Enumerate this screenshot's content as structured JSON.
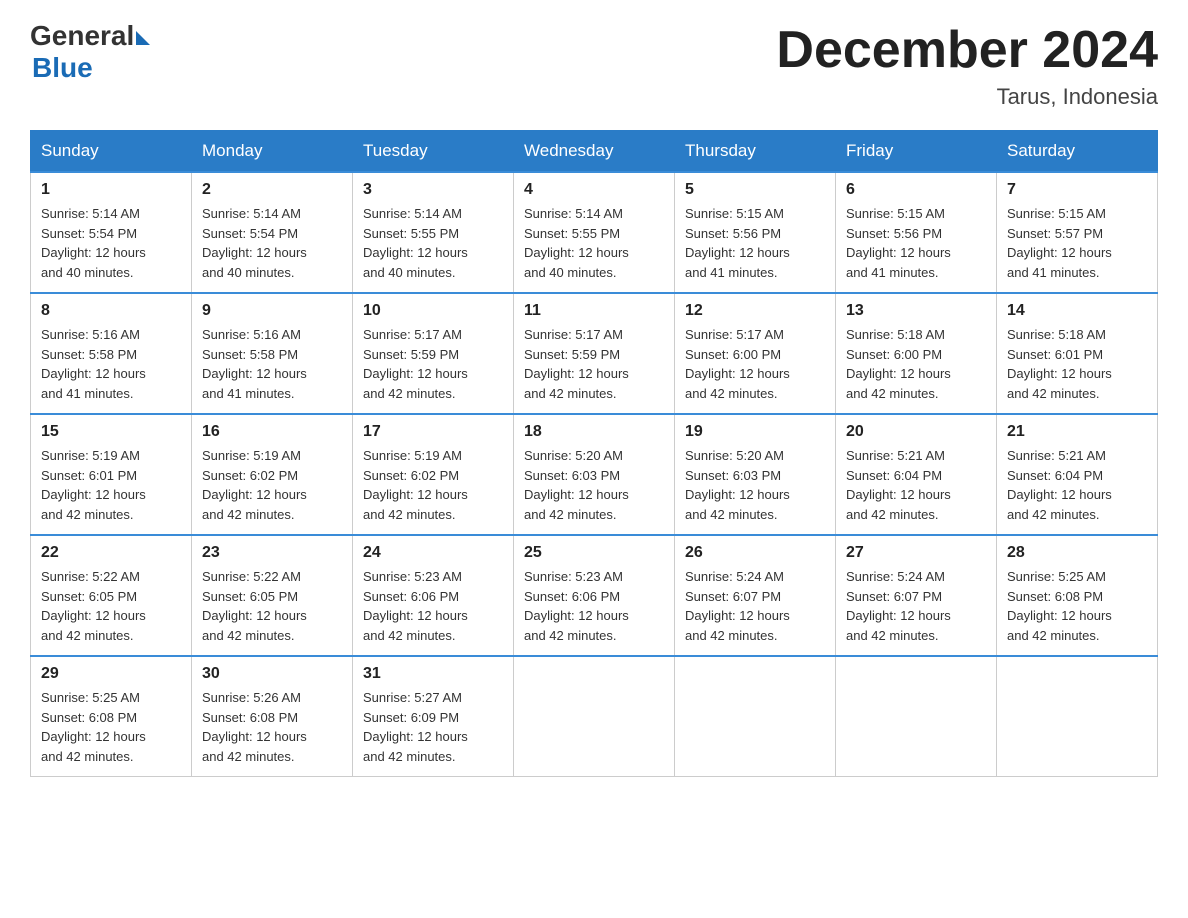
{
  "header": {
    "logo_general": "General",
    "logo_blue": "Blue",
    "month_title": "December 2024",
    "location": "Tarus, Indonesia"
  },
  "days_of_week": [
    "Sunday",
    "Monday",
    "Tuesday",
    "Wednesday",
    "Thursday",
    "Friday",
    "Saturday"
  ],
  "weeks": [
    [
      {
        "day": "1",
        "sunrise": "5:14 AM",
        "sunset": "5:54 PM",
        "daylight": "12 hours and 40 minutes."
      },
      {
        "day": "2",
        "sunrise": "5:14 AM",
        "sunset": "5:54 PM",
        "daylight": "12 hours and 40 minutes."
      },
      {
        "day": "3",
        "sunrise": "5:14 AM",
        "sunset": "5:55 PM",
        "daylight": "12 hours and 40 minutes."
      },
      {
        "day": "4",
        "sunrise": "5:14 AM",
        "sunset": "5:55 PM",
        "daylight": "12 hours and 40 minutes."
      },
      {
        "day": "5",
        "sunrise": "5:15 AM",
        "sunset": "5:56 PM",
        "daylight": "12 hours and 41 minutes."
      },
      {
        "day": "6",
        "sunrise": "5:15 AM",
        "sunset": "5:56 PM",
        "daylight": "12 hours and 41 minutes."
      },
      {
        "day": "7",
        "sunrise": "5:15 AM",
        "sunset": "5:57 PM",
        "daylight": "12 hours and 41 minutes."
      }
    ],
    [
      {
        "day": "8",
        "sunrise": "5:16 AM",
        "sunset": "5:58 PM",
        "daylight": "12 hours and 41 minutes."
      },
      {
        "day": "9",
        "sunrise": "5:16 AM",
        "sunset": "5:58 PM",
        "daylight": "12 hours and 41 minutes."
      },
      {
        "day": "10",
        "sunrise": "5:17 AM",
        "sunset": "5:59 PM",
        "daylight": "12 hours and 42 minutes."
      },
      {
        "day": "11",
        "sunrise": "5:17 AM",
        "sunset": "5:59 PM",
        "daylight": "12 hours and 42 minutes."
      },
      {
        "day": "12",
        "sunrise": "5:17 AM",
        "sunset": "6:00 PM",
        "daylight": "12 hours and 42 minutes."
      },
      {
        "day": "13",
        "sunrise": "5:18 AM",
        "sunset": "6:00 PM",
        "daylight": "12 hours and 42 minutes."
      },
      {
        "day": "14",
        "sunrise": "5:18 AM",
        "sunset": "6:01 PM",
        "daylight": "12 hours and 42 minutes."
      }
    ],
    [
      {
        "day": "15",
        "sunrise": "5:19 AM",
        "sunset": "6:01 PM",
        "daylight": "12 hours and 42 minutes."
      },
      {
        "day": "16",
        "sunrise": "5:19 AM",
        "sunset": "6:02 PM",
        "daylight": "12 hours and 42 minutes."
      },
      {
        "day": "17",
        "sunrise": "5:19 AM",
        "sunset": "6:02 PM",
        "daylight": "12 hours and 42 minutes."
      },
      {
        "day": "18",
        "sunrise": "5:20 AM",
        "sunset": "6:03 PM",
        "daylight": "12 hours and 42 minutes."
      },
      {
        "day": "19",
        "sunrise": "5:20 AM",
        "sunset": "6:03 PM",
        "daylight": "12 hours and 42 minutes."
      },
      {
        "day": "20",
        "sunrise": "5:21 AM",
        "sunset": "6:04 PM",
        "daylight": "12 hours and 42 minutes."
      },
      {
        "day": "21",
        "sunrise": "5:21 AM",
        "sunset": "6:04 PM",
        "daylight": "12 hours and 42 minutes."
      }
    ],
    [
      {
        "day": "22",
        "sunrise": "5:22 AM",
        "sunset": "6:05 PM",
        "daylight": "12 hours and 42 minutes."
      },
      {
        "day": "23",
        "sunrise": "5:22 AM",
        "sunset": "6:05 PM",
        "daylight": "12 hours and 42 minutes."
      },
      {
        "day": "24",
        "sunrise": "5:23 AM",
        "sunset": "6:06 PM",
        "daylight": "12 hours and 42 minutes."
      },
      {
        "day": "25",
        "sunrise": "5:23 AM",
        "sunset": "6:06 PM",
        "daylight": "12 hours and 42 minutes."
      },
      {
        "day": "26",
        "sunrise": "5:24 AM",
        "sunset": "6:07 PM",
        "daylight": "12 hours and 42 minutes."
      },
      {
        "day": "27",
        "sunrise": "5:24 AM",
        "sunset": "6:07 PM",
        "daylight": "12 hours and 42 minutes."
      },
      {
        "day": "28",
        "sunrise": "5:25 AM",
        "sunset": "6:08 PM",
        "daylight": "12 hours and 42 minutes."
      }
    ],
    [
      {
        "day": "29",
        "sunrise": "5:25 AM",
        "sunset": "6:08 PM",
        "daylight": "12 hours and 42 minutes."
      },
      {
        "day": "30",
        "sunrise": "5:26 AM",
        "sunset": "6:08 PM",
        "daylight": "12 hours and 42 minutes."
      },
      {
        "day": "31",
        "sunrise": "5:27 AM",
        "sunset": "6:09 PM",
        "daylight": "12 hours and 42 minutes."
      },
      null,
      null,
      null,
      null
    ]
  ],
  "labels": {
    "sunrise": "Sunrise:",
    "sunset": "Sunset:",
    "daylight": "Daylight:"
  }
}
